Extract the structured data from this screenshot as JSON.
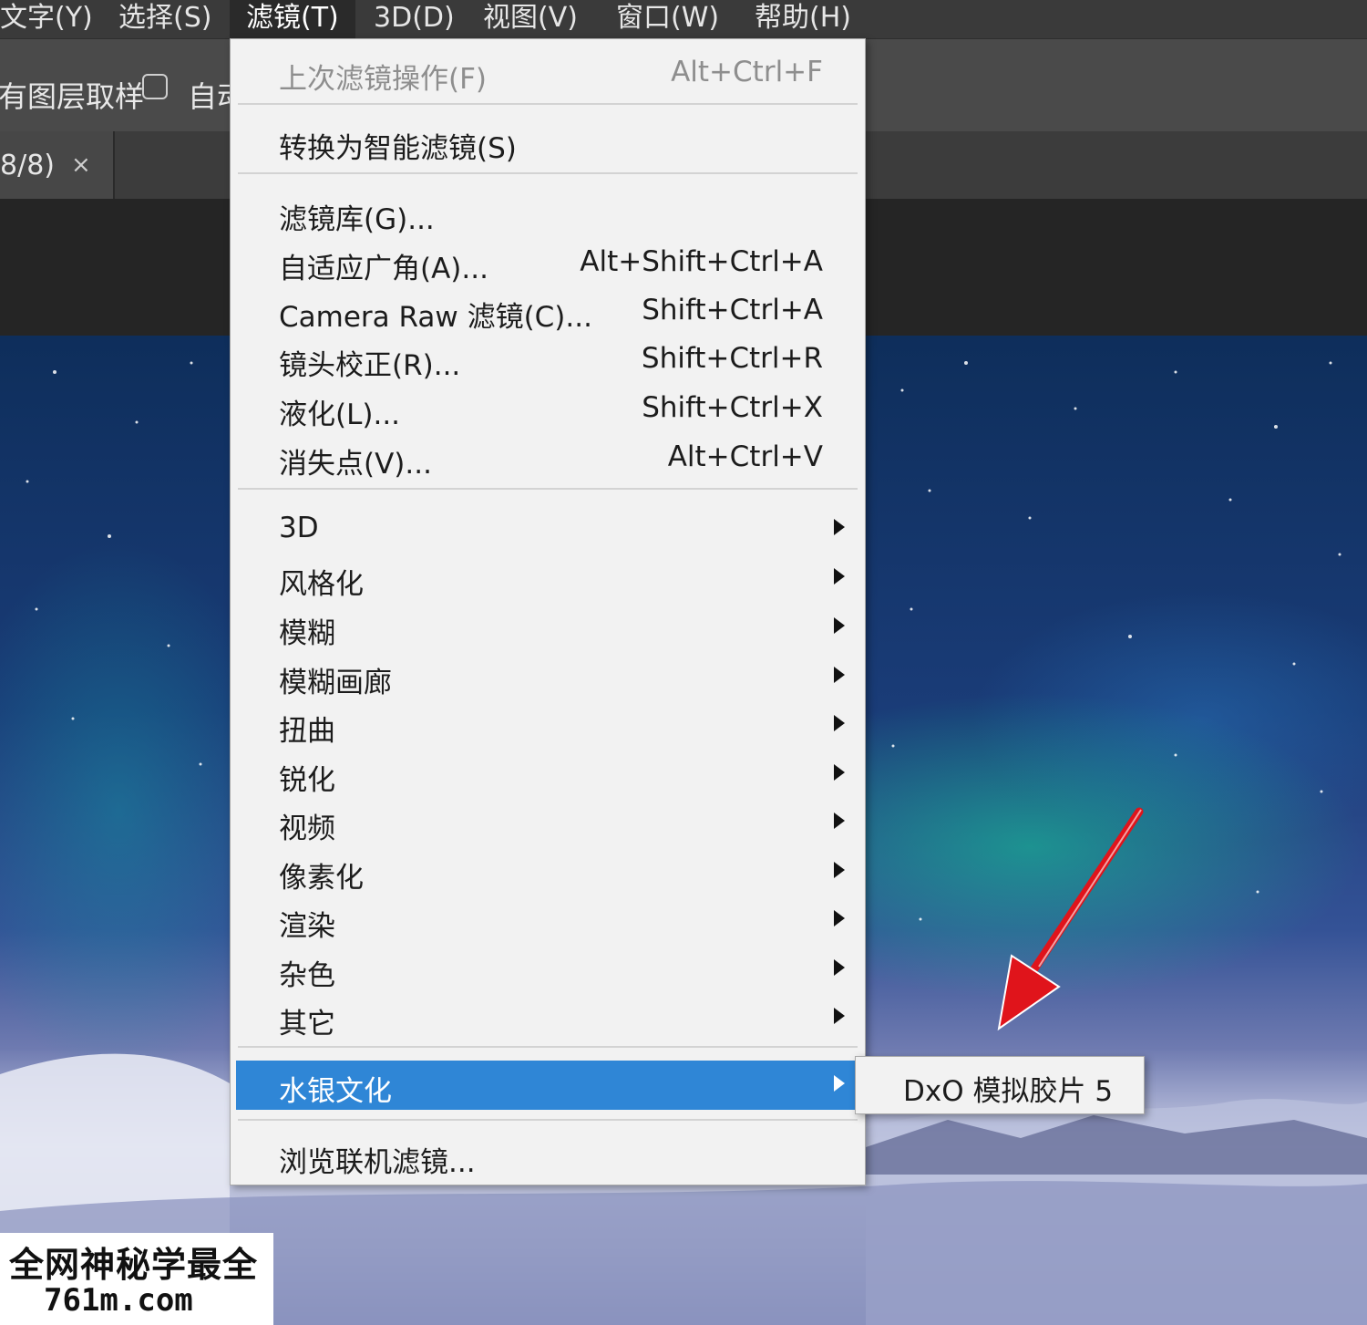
{
  "menubar": {
    "items": [
      "文字(Y)",
      "选择(S)",
      "滤镜(T)",
      "3D(D)",
      "视图(V)",
      "窗口(W)",
      "帮助(H)"
    ],
    "active_index": 2
  },
  "options_bar": {
    "sample_label": "对所有图层取样",
    "auto_label": "自动"
  },
  "tab": {
    "title": "8/8)",
    "close": "×"
  },
  "filter_menu": {
    "last_filter": {
      "label": "上次滤镜操作(F)",
      "shortcut": "Alt+Ctrl+F"
    },
    "convert_smart": {
      "label": "转换为智能滤镜(S)"
    },
    "filters": [
      {
        "label": "滤镜库(G)...",
        "shortcut": ""
      },
      {
        "label": "自适应广角(A)...",
        "shortcut": "Alt+Shift+Ctrl+A"
      },
      {
        "label": "Camera Raw 滤镜(C)...",
        "shortcut": "Shift+Ctrl+A"
      },
      {
        "label": "镜头校正(R)...",
        "shortcut": "Shift+Ctrl+R"
      },
      {
        "label": "液化(L)...",
        "shortcut": "Shift+Ctrl+X"
      },
      {
        "label": "消失点(V)...",
        "shortcut": "Alt+Ctrl+V"
      }
    ],
    "submenus": [
      "3D",
      "风格化",
      "模糊",
      "模糊画廊",
      "扭曲",
      "锐化",
      "视频",
      "像素化",
      "渲染",
      "杂色",
      "其它"
    ],
    "plugin": {
      "label": "水银文化"
    },
    "browse": {
      "label": "浏览联机滤镜..."
    }
  },
  "plugin_submenu": {
    "label": "DxO 模拟胶片 5"
  },
  "annotation": {
    "color": "#e0141b"
  },
  "colors": {
    "highlight": "#2f86d6",
    "menu_bg": "#f2f2f2"
  },
  "watermark": {
    "line1": "全网神秘学最全",
    "line2": "761m.com"
  }
}
